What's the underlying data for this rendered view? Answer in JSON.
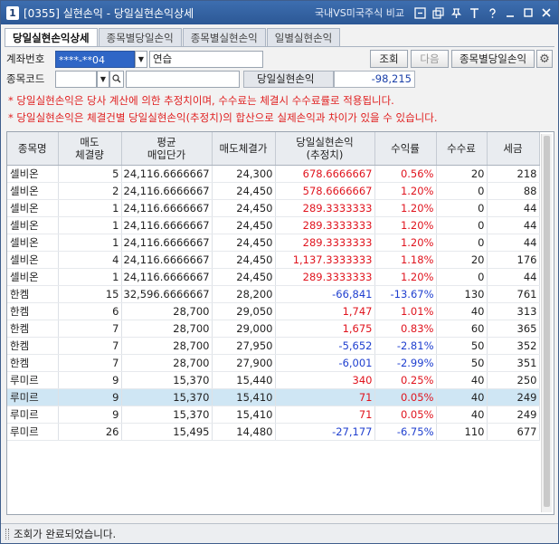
{
  "window": {
    "number": "1",
    "title": "[0355] 실현손익 - 당일실현손익상세",
    "compare_link": "국내VS미국주식 비교"
  },
  "tabs": [
    "당일실현손익상세",
    "종목별당일손익",
    "종목별실현손익",
    "일별실현손익"
  ],
  "account": {
    "label": "계좌번호",
    "number": "****-**04",
    "name": "연습"
  },
  "stock": {
    "label": "종목코드",
    "value": "",
    "name": ""
  },
  "buttons": {
    "query": "조회",
    "next": "다음",
    "by_stock": "종목별당일손익"
  },
  "summary": {
    "label": "당일실현손익",
    "value": "-98,215"
  },
  "notices": [
    "* 당일실현손익은 당사 계산에 의한 추정치이며, 수수료는 체결시 수수료률로 적용됩니다.",
    "* 당일실현손익은 체결건별 당일실현손익(추정치)의 합산으로 실제손익과 차이가 있을 수 있습니다."
  ],
  "table": {
    "headers": [
      "종목명",
      "매도\n체결량",
      "평균\n매입단가",
      "매도체결가",
      "당일실현손익\n(추정치)",
      "수익률",
      "수수료",
      "세금"
    ],
    "rows": [
      {
        "name": "셀비온",
        "qty": "5",
        "avg": "24,116.6666667",
        "sell": "24,300",
        "pnl": "678.6666667",
        "rate": "0.56%",
        "fee": "20",
        "tax": "218",
        "sign": "pos"
      },
      {
        "name": "셀비온",
        "qty": "2",
        "avg": "24,116.6666667",
        "sell": "24,450",
        "pnl": "578.6666667",
        "rate": "1.20%",
        "fee": "0",
        "tax": "88",
        "sign": "pos"
      },
      {
        "name": "셀비온",
        "qty": "1",
        "avg": "24,116.6666667",
        "sell": "24,450",
        "pnl": "289.3333333",
        "rate": "1.20%",
        "fee": "0",
        "tax": "44",
        "sign": "pos"
      },
      {
        "name": "셀비온",
        "qty": "1",
        "avg": "24,116.6666667",
        "sell": "24,450",
        "pnl": "289.3333333",
        "rate": "1.20%",
        "fee": "0",
        "tax": "44",
        "sign": "pos"
      },
      {
        "name": "셀비온",
        "qty": "1",
        "avg": "24,116.6666667",
        "sell": "24,450",
        "pnl": "289.3333333",
        "rate": "1.20%",
        "fee": "0",
        "tax": "44",
        "sign": "pos"
      },
      {
        "name": "셀비온",
        "qty": "4",
        "avg": "24,116.6666667",
        "sell": "24,450",
        "pnl": "1,137.3333333",
        "rate": "1.18%",
        "fee": "20",
        "tax": "176",
        "sign": "pos"
      },
      {
        "name": "셀비온",
        "qty": "1",
        "avg": "24,116.6666667",
        "sell": "24,450",
        "pnl": "289.3333333",
        "rate": "1.20%",
        "fee": "0",
        "tax": "44",
        "sign": "pos"
      },
      {
        "name": "한켐",
        "qty": "15",
        "avg": "32,596.6666667",
        "sell": "28,200",
        "pnl": "-66,841",
        "rate": "-13.67%",
        "fee": "130",
        "tax": "761",
        "sign": "neg"
      },
      {
        "name": "한켐",
        "qty": "6",
        "avg": "28,700",
        "sell": "29,050",
        "pnl": "1,747",
        "rate": "1.01%",
        "fee": "40",
        "tax": "313",
        "sign": "pos"
      },
      {
        "name": "한켐",
        "qty": "7",
        "avg": "28,700",
        "sell": "29,000",
        "pnl": "1,675",
        "rate": "0.83%",
        "fee": "60",
        "tax": "365",
        "sign": "pos"
      },
      {
        "name": "한켐",
        "qty": "7",
        "avg": "28,700",
        "sell": "27,950",
        "pnl": "-5,652",
        "rate": "-2.81%",
        "fee": "50",
        "tax": "352",
        "sign": "neg"
      },
      {
        "name": "한켐",
        "qty": "7",
        "avg": "28,700",
        "sell": "27,900",
        "pnl": "-6,001",
        "rate": "-2.99%",
        "fee": "50",
        "tax": "351",
        "sign": "neg"
      },
      {
        "name": "루미르",
        "qty": "9",
        "avg": "15,370",
        "sell": "15,440",
        "pnl": "340",
        "rate": "0.25%",
        "fee": "40",
        "tax": "250",
        "sign": "pos"
      },
      {
        "name": "루미르",
        "qty": "9",
        "avg": "15,370",
        "sell": "15,410",
        "pnl": "71",
        "rate": "0.05%",
        "fee": "40",
        "tax": "249",
        "sign": "pos"
      },
      {
        "name": "루미르",
        "qty": "9",
        "avg": "15,370",
        "sell": "15,410",
        "pnl": "71",
        "rate": "0.05%",
        "fee": "40",
        "tax": "249",
        "sign": "pos"
      },
      {
        "name": "루미르",
        "qty": "26",
        "avg": "15,495",
        "sell": "14,480",
        "pnl": "-27,177",
        "rate": "-6.75%",
        "fee": "110",
        "tax": "677",
        "sign": "neg"
      }
    ],
    "selected_row": 13
  },
  "status": "조회가 완료되었습니다.",
  "colors": {
    "positive": "#e0141e",
    "negative": "#1f3fcf",
    "selected_row": "#cfe6f4",
    "title_bar": "#2c5896"
  }
}
